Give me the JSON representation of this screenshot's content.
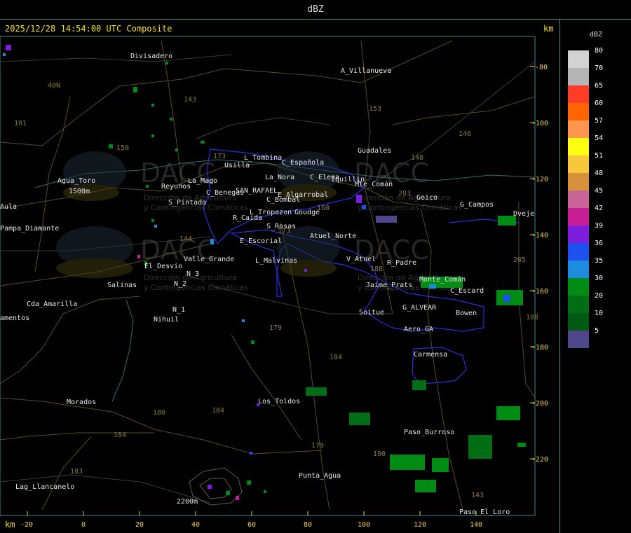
{
  "window": {
    "title": "dBZ"
  },
  "map": {
    "header_datetime": "2025/12/28 14:54:00 UTC Composite",
    "km_top_label": "km",
    "km_bottom_label": "km",
    "x_ticks": [
      "-20",
      "0",
      "20",
      "40",
      "60",
      "80",
      "100",
      "120",
      "140"
    ],
    "y_ticks": [
      "-80",
      "-100",
      "-120",
      "-140",
      "-160",
      "-180",
      "-200",
      "-220"
    ],
    "watermark": {
      "brand": "DACC",
      "line1": "Dirección de Agricultura",
      "line2": "y Contingencias Climáticas"
    },
    "places": [
      "Divisadero",
      "A_Villanueva",
      "Guadales",
      "L_Tombina",
      "Usilla",
      "C_Española",
      "La_Nora",
      "C_Elena",
      "Iquillin",
      "Mte_Comán",
      "Agua_Toro",
      "Reyunos",
      "La_Mago",
      "C_Benegas",
      "SAN_RAFAEL",
      "E_Algarrobal",
      "C_Bombal",
      "Goico",
      "G_Campos",
      "Dveje",
      "S_Pintada",
      "L_Tropezon",
      "Goudge",
      "Aula",
      "Pampa_Diamante",
      "R_Caida",
      "S_Rosas",
      "Atuel_Norte",
      "E_Escorial",
      "L_Malvinas",
      "V_Atuel",
      "R_Padre",
      "Valle_Grande",
      "El_Desvio",
      "Salinas",
      "N_2",
      "N_3",
      "Jaime_Prats",
      "Monte_Comán",
      "C_Escard",
      "Cda_Amarilla",
      "N_1",
      "Nihuil",
      "Soitue",
      "G_ALVEAR",
      "Bowen",
      "amentos",
      "Aero_GA",
      "Carmensa",
      "Morados",
      "Los_Toldos",
      "Paso_Burroso",
      "Punta_Agua",
      "Lag_Llancanelo",
      "Paso_El_Loro",
      "2200m",
      "1500m"
    ],
    "road_numbers": [
      "143",
      "153",
      "146",
      "148",
      "150",
      "173",
      "101",
      "40N",
      "203",
      "144",
      "173",
      "188",
      "160",
      "205",
      "179",
      "184",
      "180",
      "188",
      "184",
      "183",
      "184",
      "179",
      "190",
      "143"
    ],
    "radar_echoes": "scattered weak echoes (10–30 dBZ) with isolated 35–36 dBZ cells"
  },
  "legend": {
    "title": "dBZ",
    "items": [
      {
        "value": "80",
        "color": "#d2d2d2"
      },
      {
        "value": "70",
        "color": "#b4b4b4"
      },
      {
        "value": "65",
        "color": "#ff3c28"
      },
      {
        "value": "60",
        "color": "#ff6400"
      },
      {
        "value": "57",
        "color": "#ff9650"
      },
      {
        "value": "54",
        "color": "#ffff14"
      },
      {
        "value": "51",
        "color": "#f8c83c"
      },
      {
        "value": "48",
        "color": "#d7913c"
      },
      {
        "value": "45",
        "color": "#c86496"
      },
      {
        "value": "42",
        "color": "#c81e96"
      },
      {
        "value": "39",
        "color": "#7d1edc"
      },
      {
        "value": "36",
        "color": "#1e50f0"
      },
      {
        "value": "35",
        "color": "#1e8cdc"
      },
      {
        "value": "30",
        "color": "#008c14"
      },
      {
        "value": "20",
        "color": "#006e14"
      },
      {
        "value": "10",
        "color": "#005a14"
      },
      {
        "value": "5",
        "color": "#50468c"
      }
    ]
  }
}
